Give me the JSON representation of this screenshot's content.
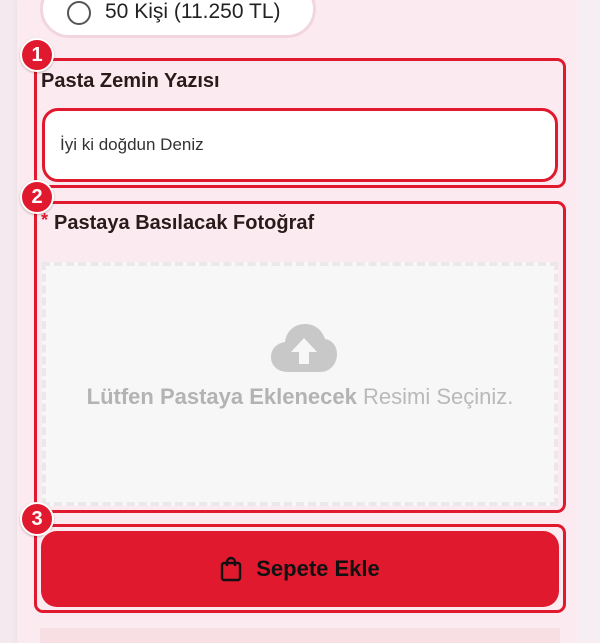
{
  "option": {
    "label": "50 Kişi (11.250 TL)"
  },
  "markers": [
    "1",
    "2",
    "3"
  ],
  "cake_text": {
    "title": "Pasta Zemin Yazısı",
    "value": "İyi ki doğdun Deniz"
  },
  "photo": {
    "required_mark": "*",
    "title": "Pastaya Basılacak Fotoğraf",
    "upload_bold": "Lütfen Pastaya Eklenecek",
    "upload_rest": " Resimi Seçiniz."
  },
  "cart": {
    "label": "Sepete Ekle"
  },
  "colors": {
    "accent": "#e0192e",
    "panel": "#fbeaef"
  },
  "icons": {
    "upload": "cloud-upload-icon",
    "cart": "shopping-bag-icon"
  }
}
